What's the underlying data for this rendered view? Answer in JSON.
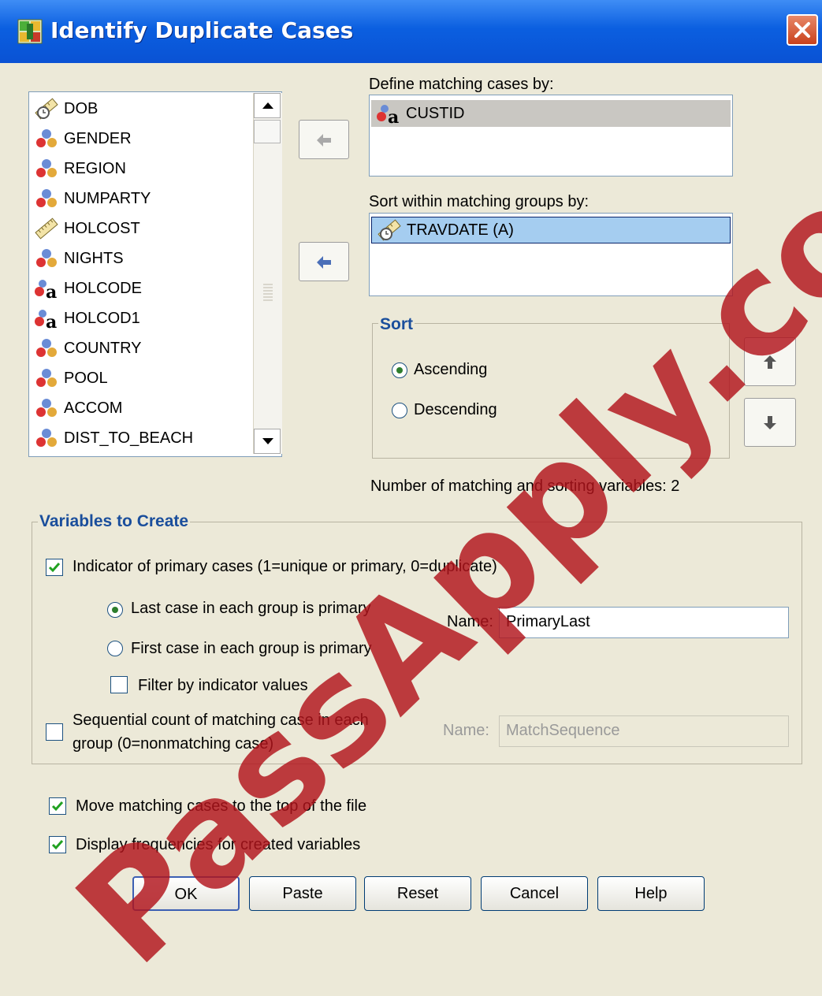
{
  "window": {
    "title": "Identify Duplicate Cases"
  },
  "source_list": {
    "items": [
      {
        "label": "DOB",
        "icon": "date-ruler-icon"
      },
      {
        "label": "GENDER",
        "icon": "nominal-icon"
      },
      {
        "label": "REGION",
        "icon": "nominal-icon"
      },
      {
        "label": "NUMPARTY",
        "icon": "nominal-icon"
      },
      {
        "label": "HOLCOST",
        "icon": "scale-ruler-icon"
      },
      {
        "label": "NIGHTS",
        "icon": "nominal-icon"
      },
      {
        "label": "HOLCODE",
        "icon": "string-nominal-icon"
      },
      {
        "label": "HOLCOD1",
        "icon": "string-nominal-icon"
      },
      {
        "label": "COUNTRY",
        "icon": "nominal-icon"
      },
      {
        "label": "POOL",
        "icon": "nominal-icon"
      },
      {
        "label": "ACCOM",
        "icon": "nominal-icon"
      },
      {
        "label": "DIST_TO_BEACH",
        "icon": "nominal-icon"
      }
    ]
  },
  "define_matching": {
    "label": "Define matching cases by:",
    "items": [
      {
        "label": "CUSTID",
        "icon": "string-nominal-icon"
      }
    ]
  },
  "sort_within": {
    "label": "Sort within matching groups by:",
    "items": [
      {
        "label": "TRAVDATE (A)",
        "icon": "date-ruler-icon"
      }
    ]
  },
  "sort_group": {
    "title": "Sort",
    "ascending": "Ascending",
    "descending": "Descending",
    "selected": "Ascending"
  },
  "count_text": "Number of matching and sorting variables: 2",
  "variables_to_create": {
    "title": "Variables to Create",
    "indicator_label": "Indicator of primary cases (1=unique or primary, 0=duplicate)",
    "indicator_checked": true,
    "last_case": "Last case in each group is primary",
    "first_case": "First case in each group is primary",
    "primary_selected": "last",
    "filter_label": "Filter by indicator values",
    "filter_checked": false,
    "name_label": "Name:",
    "name_value": "PrimaryLast",
    "sequential_label_line1": "Sequential count of matching case in each",
    "sequential_label_line2": "group (0=nonmatching case)",
    "sequential_checked": false,
    "seq_name_label": "Name:",
    "seq_name_value": "MatchSequence"
  },
  "move_matching": {
    "label": "Move matching cases to the top of the file",
    "checked": true
  },
  "display_freq": {
    "label": "Display frequencies for created variables",
    "checked": true
  },
  "buttons": {
    "ok": "OK",
    "paste": "Paste",
    "reset": "Reset",
    "cancel": "Cancel",
    "help": "Help"
  },
  "watermark": "PassApply.com",
  "colors": {
    "title_bar": "#0a5ee0",
    "group_title": "#1a4e9c",
    "selection": "#c9c7c2",
    "selection_blue": "#a5cdf0",
    "watermark": "#b2141c"
  }
}
